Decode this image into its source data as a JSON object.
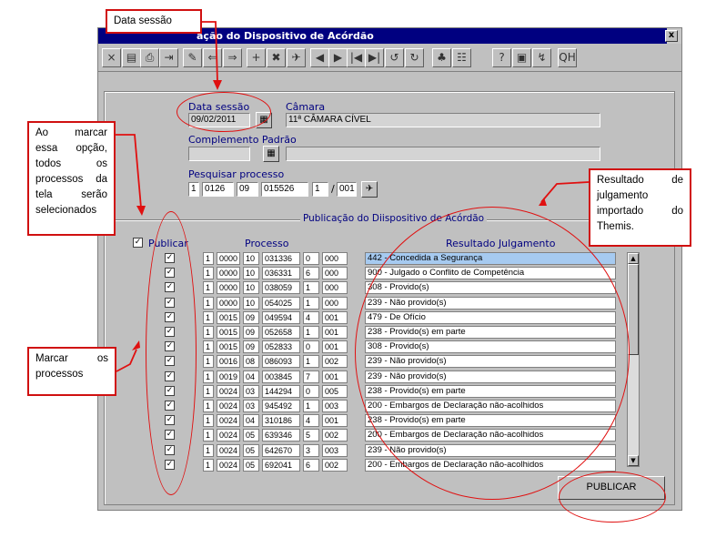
{
  "window": {
    "title": "ação do Dispositivo de Acórdão",
    "close_label": "x"
  },
  "toolbar": {
    "buttons": [
      "×",
      "▤",
      "⎙",
      "⇥",
      "✎",
      "⇐",
      "⇒",
      "+",
      "✖",
      "✈",
      "◀",
      "▶",
      "|◀",
      "▶|",
      "↺",
      "↻",
      "♣",
      "☷",
      "?",
      "▣",
      "↯",
      "QH"
    ]
  },
  "form": {
    "data_sessao_label": "Data sessão",
    "data_sessao_value": "09/02/2011",
    "camara_label": "Câmara",
    "camara_value": "11ª CÂMARA CÍVEL",
    "complemento_label": "Complemento Padrão",
    "pesquisar_label": "Pesquisar processo",
    "pesq": [
      "1",
      "0126",
      "09",
      "015526",
      "1",
      "001"
    ],
    "slash": "/"
  },
  "group_title": "Publicação do Diispositivo de Acórdão",
  "headers": {
    "publicar": "Publicar",
    "processo": "Processo",
    "resultado": "Resultado Julgamento"
  },
  "rows": [
    {
      "p": [
        "1",
        "0000",
        "10",
        "031336",
        "0",
        "000"
      ],
      "r": "442 - Concedida a Segurança",
      "sel": true
    },
    {
      "p": [
        "1",
        "0000",
        "10",
        "036331",
        "6",
        "000"
      ],
      "r": "900 - Julgado o Conflito de Competência"
    },
    {
      "p": [
        "1",
        "0000",
        "10",
        "038059",
        "1",
        "000"
      ],
      "r": "308 - Provido(s)"
    },
    {
      "p": [
        "1",
        "0000",
        "10",
        "054025",
        "1",
        "000"
      ],
      "r": "239 - Não provido(s)"
    },
    {
      "p": [
        "1",
        "0015",
        "09",
        "049594",
        "4",
        "001"
      ],
      "r": "479 - De Ofício"
    },
    {
      "p": [
        "1",
        "0015",
        "09",
        "052658",
        "1",
        "001"
      ],
      "r": "238 - Provido(s) em parte"
    },
    {
      "p": [
        "1",
        "0015",
        "09",
        "052833",
        "0",
        "001"
      ],
      "r": "308 - Provido(s)"
    },
    {
      "p": [
        "1",
        "0016",
        "08",
        "086093",
        "1",
        "002"
      ],
      "r": "239 - Não provido(s)"
    },
    {
      "p": [
        "1",
        "0019",
        "04",
        "003845",
        "7",
        "001"
      ],
      "r": "239 - Não provido(s)"
    },
    {
      "p": [
        "1",
        "0024",
        "03",
        "144294",
        "0",
        "005"
      ],
      "r": "238 - Provido(s) em parte"
    },
    {
      "p": [
        "1",
        "0024",
        "03",
        "945492",
        "1",
        "003"
      ],
      "r": "200 - Embargos de Declaração não-acolhidos"
    },
    {
      "p": [
        "1",
        "0024",
        "04",
        "310186",
        "4",
        "001"
      ],
      "r": "238 - Provido(s) em parte"
    },
    {
      "p": [
        "1",
        "0024",
        "05",
        "639346",
        "5",
        "002"
      ],
      "r": "200 - Embargos de Declaração não-acolhidos"
    },
    {
      "p": [
        "1",
        "0024",
        "05",
        "642670",
        "3",
        "003"
      ],
      "r": "239 - Não provido(s)"
    },
    {
      "p": [
        "1",
        "0024",
        "05",
        "692041",
        "6",
        "002"
      ],
      "r": "200 - Embargos de Declaração não-acolhidos"
    }
  ],
  "publicar_button": "PUBLICAR",
  "checkmark": "✓",
  "callouts": {
    "data_sessao": "Data sessão",
    "ao_marcar": "Ao marcar essa opção, todos os processos da tela serão selecionados",
    "marcar_processos": "Marcar os processos",
    "resultado": "Resultado de julgamento importado do Themis."
  },
  "colors": {
    "title_bg": "#000080",
    "annotation": "#e01010",
    "selected_row": "#a6caf0"
  }
}
